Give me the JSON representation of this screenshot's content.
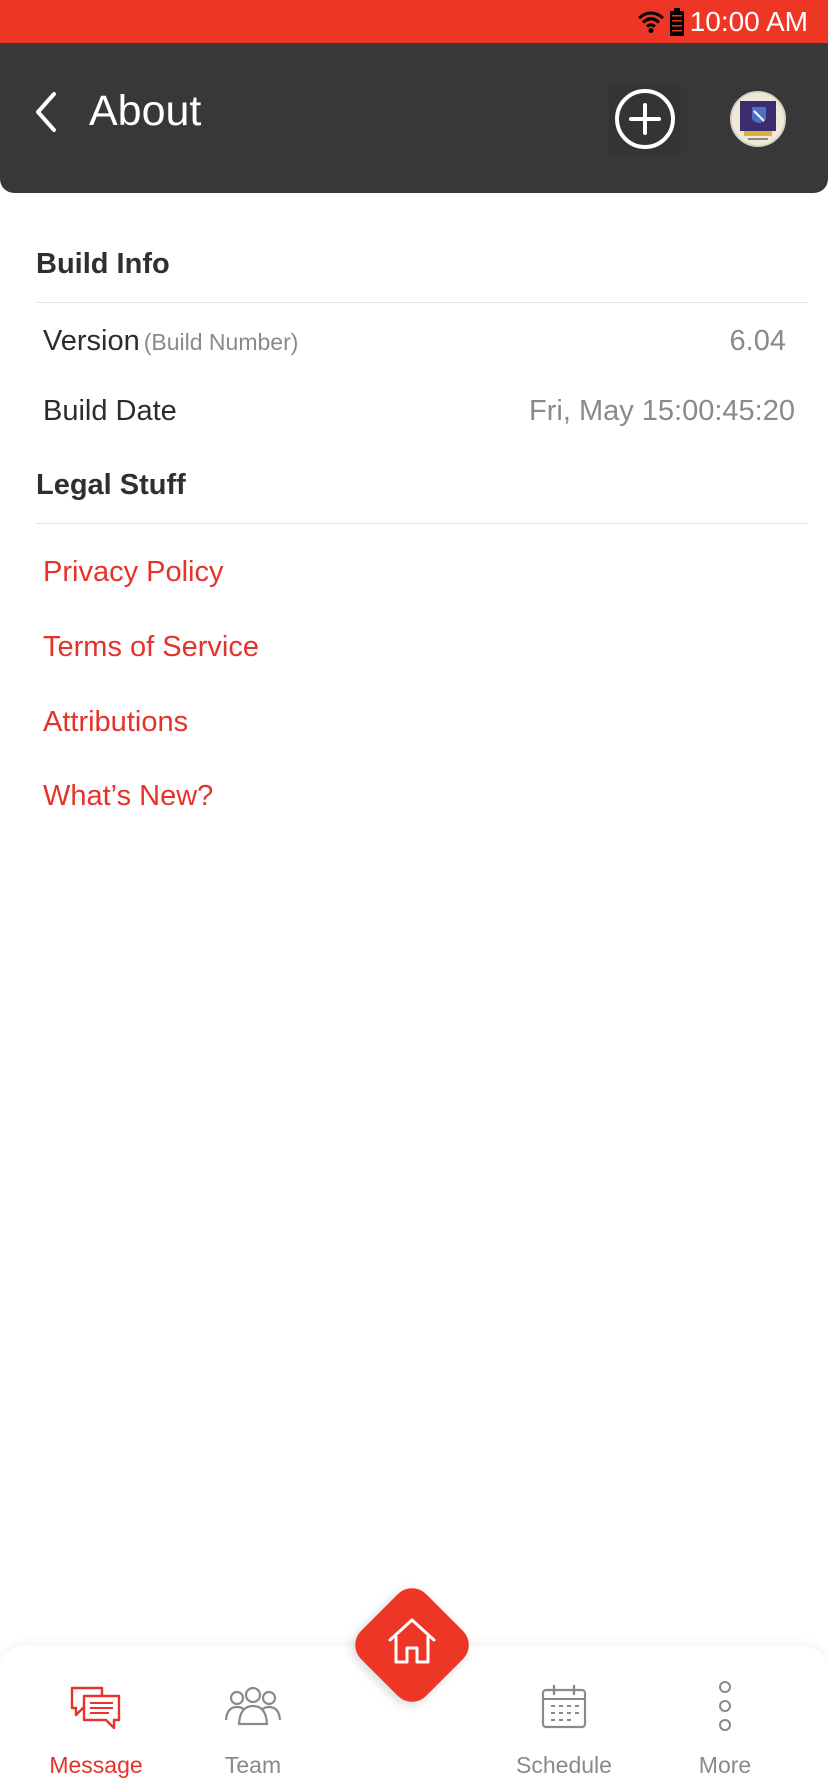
{
  "status_bar": {
    "time": "10:00 AM"
  },
  "header": {
    "title": "About"
  },
  "build_info": {
    "title": "Build Info",
    "version_label": "Version",
    "version_sub": "(Build Number)",
    "version_value": "6.04",
    "build_date_label": "Build Date",
    "build_date_value": "Fri, May 15:00:45:20"
  },
  "legal": {
    "title": "Legal Stuff",
    "links": [
      "Privacy Policy",
      "Terms of Service",
      "Attributions",
      "What’s New?"
    ]
  },
  "bottom_nav": {
    "items": [
      {
        "label": "Message",
        "icon": "message-icon",
        "active": true
      },
      {
        "label": "Team",
        "icon": "team-icon",
        "active": false
      },
      {
        "label": "Schedule",
        "icon": "calendar-icon",
        "active": false
      },
      {
        "label": "More",
        "icon": "more-icon",
        "active": false
      }
    ],
    "home_icon": "home-icon"
  },
  "colors": {
    "accent": "#ee3626",
    "header_bg": "#383838",
    "link": "#e5332a"
  }
}
